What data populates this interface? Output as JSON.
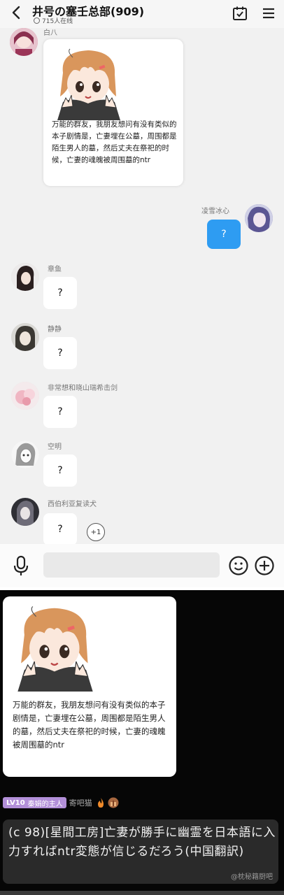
{
  "header": {
    "title": "井号の塞壬总部(909)",
    "online": "715人在线"
  },
  "top_sender": {
    "name": "白八",
    "card_text": "万能的群友，我朋友想问有没有类似的本子剧情是，亡妻埋在公墓，周围都是陌生男人的墓，然后丈夫在祭祀的时候，亡妻的魂魄被周围墓的ntr"
  },
  "self_message": {
    "name": "凌雪冰心",
    "text": "?"
  },
  "messages": [
    {
      "name": "章鱼",
      "text": "?"
    },
    {
      "name": "静静",
      "text": "?"
    },
    {
      "name": "非常想和晓山瑞希击剑",
      "text": "?"
    },
    {
      "name": "空明",
      "text": "?"
    },
    {
      "name": "西伯利亚复读犬",
      "text": "?"
    }
  ],
  "plus_one": "+1",
  "icons": {
    "back": "chevron-left-icon",
    "calendar": "calendar-check-icon",
    "menu": "hamburger-menu-icon",
    "voice": "microphone-icon",
    "emoji": "smiley-icon",
    "add": "plus-circle-icon"
  },
  "repost": {
    "card_text": "万能的群友，我朋友想问有没有类似的本子剧情是，亡妻埋在公墓，周围都是陌生男人的墓，然后丈夫在祭祀的时候，亡妻的魂魄被周围墓的ntr",
    "badge_level": "LV10",
    "badge_title": "秦娟的主人",
    "username": "寄吧猫",
    "comment": "(c 98)[星間工房]亡妻が勝手に幽霊を日本語に入力すればntr変態が信じるだろう(中国翻訳)",
    "watermark": "@枕秘籍厨吧"
  },
  "colors": {
    "accent_blue": "#2e9cf2",
    "badge_purple": "#b28fd8",
    "dark_bg": "#060606"
  }
}
